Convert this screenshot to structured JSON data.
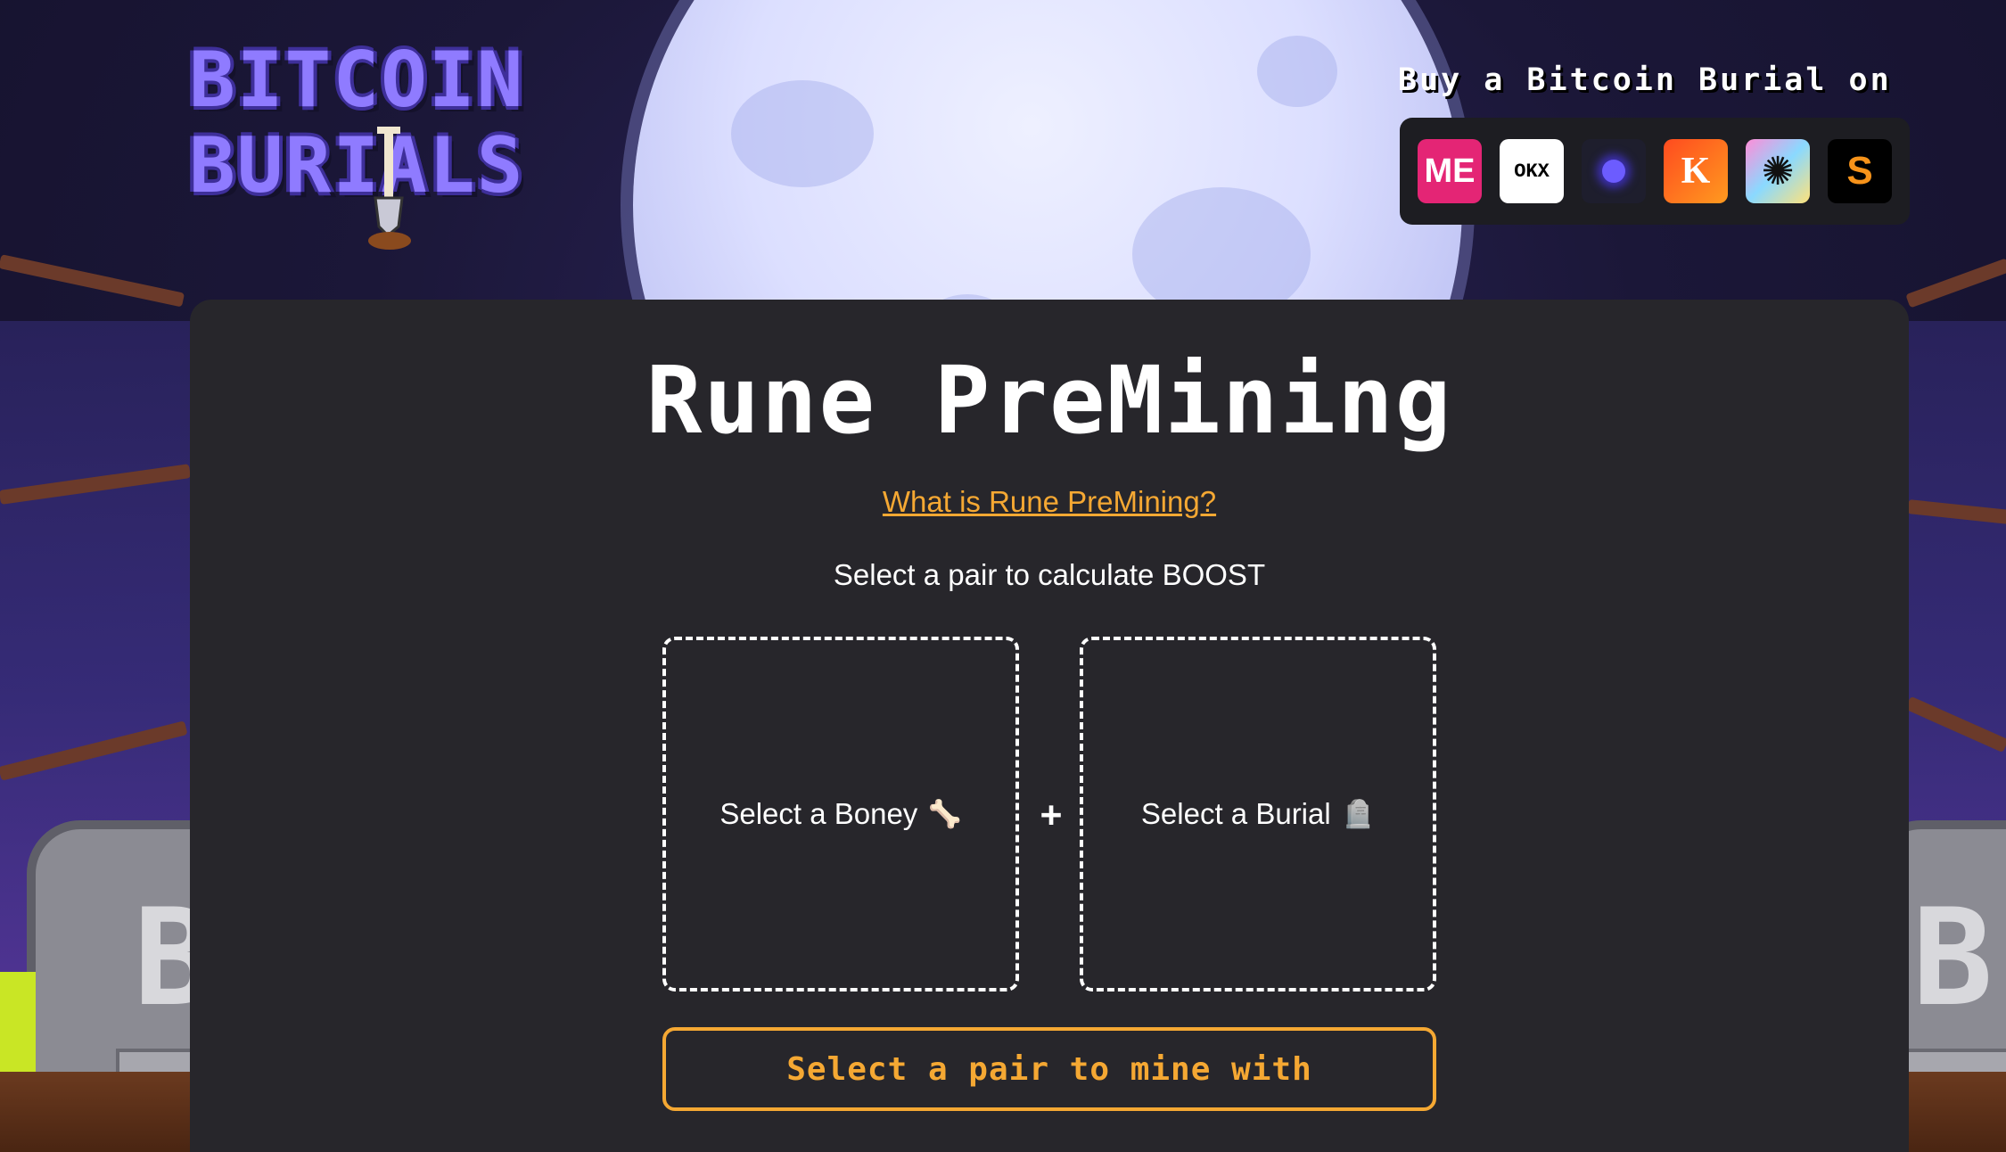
{
  "logo": {
    "line1": "BITCOIN",
    "line2": "BURIALS"
  },
  "marketplaces": {
    "label": "Buy a Bitcoin Burial on",
    "items": [
      {
        "name": "magic-eden",
        "glyph": "ME",
        "color": "#e42575"
      },
      {
        "name": "okx",
        "glyph": "OKX",
        "color": "#ffffff"
      },
      {
        "name": "orb",
        "glyph": "",
        "color": "#6c5cff"
      },
      {
        "name": "ordinals-wallet",
        "glyph": "K",
        "color": "#ff6a1f"
      },
      {
        "name": "magisat",
        "glyph": "✺",
        "color": "#8ad9ff"
      },
      {
        "name": "satflow",
        "glyph": "S",
        "color": "#f7931a"
      }
    ]
  },
  "main": {
    "title": "Rune PreMining",
    "link_text": "What is Rune PreMining?",
    "subtitle": "Select a pair to calculate BOOST",
    "boney_slot": {
      "label": "Select a Boney",
      "icon": "🦴"
    },
    "plus": "+",
    "burial_slot": {
      "label": "Select a Burial",
      "icon": "🪦"
    },
    "mine_button": "Select a pair to mine with"
  },
  "colors": {
    "accent": "#f5a833",
    "panel": "#27262b",
    "logo": "#8f7bff"
  }
}
